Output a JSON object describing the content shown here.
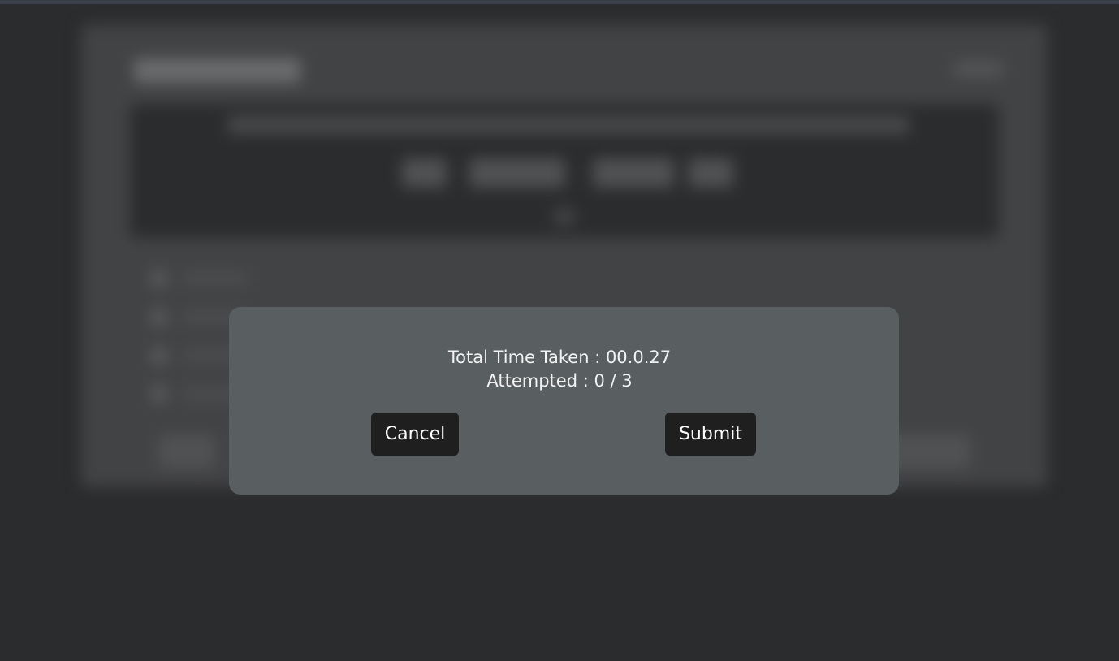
{
  "dialog": {
    "total_time": "Total Time Taken : 00.0.27",
    "attempted": "Attempted : 0 / 3",
    "cancel_label": "Cancel",
    "submit_label": "Submit"
  },
  "colors": {
    "page_background": "#2b2c2e",
    "modal_background": "#595f61",
    "button_background": "#1f1f1f",
    "text": "#f2f2f2"
  }
}
